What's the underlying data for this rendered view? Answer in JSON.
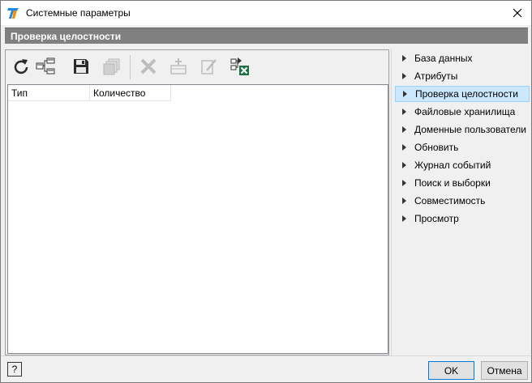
{
  "window": {
    "title": "Системные параметры"
  },
  "section": {
    "title": "Проверка целостности"
  },
  "toolbar": {
    "buttons": [
      {
        "icon": "refresh-icon",
        "enabled": true
      },
      {
        "icon": "tree-structure-icon",
        "enabled": true
      },
      {
        "icon": "save-icon",
        "enabled": true
      },
      {
        "icon": "copy-icon",
        "enabled": false
      },
      {
        "icon": "delete-icon",
        "enabled": false
      },
      {
        "icon": "add-icon",
        "enabled": false
      },
      {
        "icon": "edit-icon",
        "enabled": false
      },
      {
        "icon": "export-excel-icon",
        "enabled": true
      }
    ]
  },
  "grid": {
    "columns": [
      "Тип",
      "Количество"
    ]
  },
  "nav": {
    "items": [
      {
        "label": "База данных",
        "selected": false
      },
      {
        "label": "Атрибуты",
        "selected": false
      },
      {
        "label": "Проверка целостности",
        "selected": true
      },
      {
        "label": "Файловые хранилища",
        "selected": false
      },
      {
        "label": "Доменные пользователи",
        "selected": false
      },
      {
        "label": "Обновить",
        "selected": false
      },
      {
        "label": "Журнал событий",
        "selected": false
      },
      {
        "label": "Поиск и выборки",
        "selected": false
      },
      {
        "label": "Совместимость",
        "selected": false
      },
      {
        "label": "Просмотр",
        "selected": false
      }
    ]
  },
  "footer": {
    "help_label": "?",
    "ok_label": "OK",
    "cancel_label": "Отмена"
  },
  "colors": {
    "accent": "#0078d7",
    "header_bg": "#808080",
    "selected_bg": "#cce8ff",
    "excel_green": "#1e7145"
  }
}
